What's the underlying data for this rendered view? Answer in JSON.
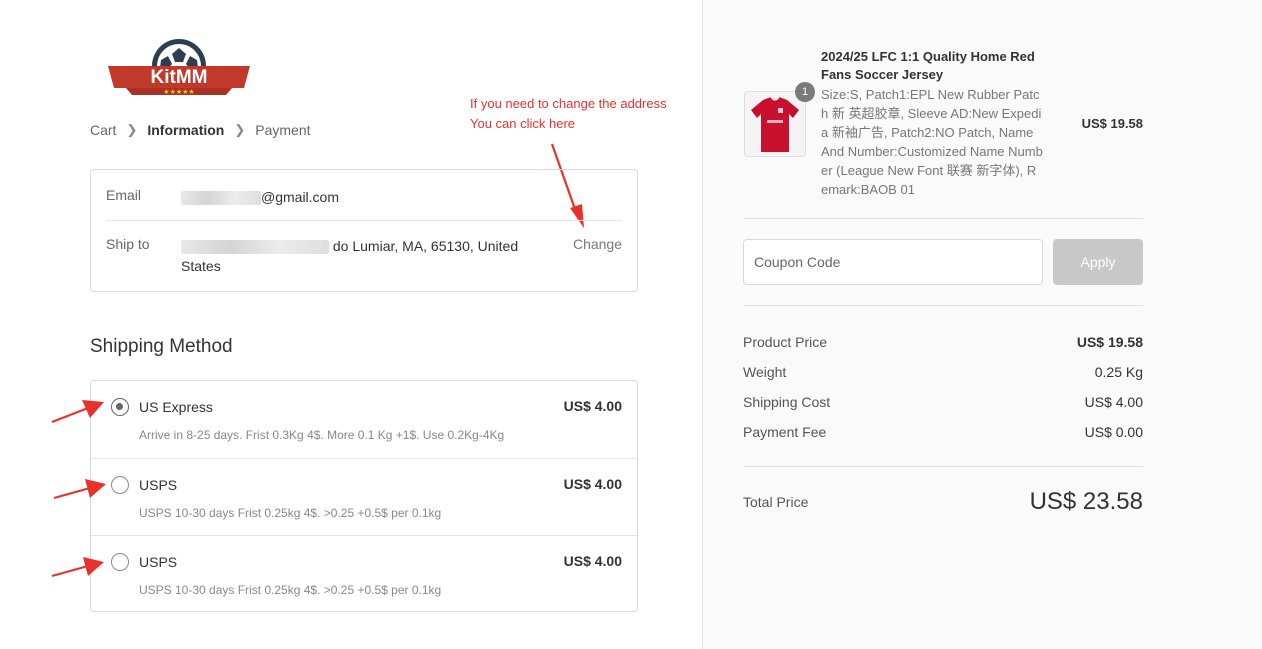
{
  "logo": {
    "text": "KitMM",
    "colors": {
      "primary": "#c0392b",
      "accent": "#f1c40f",
      "dark": "#2c3e50"
    }
  },
  "breadcrumb": {
    "items": [
      "Cart",
      "Information",
      "Payment"
    ],
    "current": "Information",
    "separator_icon": "chevron-right-icon"
  },
  "annotation": {
    "line1": "If you need to change the address",
    "line2": "You can click here",
    "color": "#e8312b"
  },
  "contact": {
    "email_label": "Email",
    "email_value": "@gmail.com",
    "ship_label": "Ship to",
    "ship_value_line1": "do Lumiar, MA, 65130, United",
    "ship_value_line2": "States",
    "change_label": "Change"
  },
  "shipping": {
    "title": "Shipping Method",
    "options": [
      {
        "name": "US Express",
        "price": "US$ 4.00",
        "desc": "Arrive in 8-25 days. Frist 0.3Kg 4$. More 0.1 Kg +1$. Use 0.2Kg-4Kg",
        "selected": true
      },
      {
        "name": "USPS",
        "price": "US$ 4.00",
        "desc": "USPS 10-30 days Frist 0.25kg 4$. >0.25 +0.5$ per 0.1kg",
        "selected": false
      },
      {
        "name": "USPS",
        "price": "US$ 4.00",
        "desc": "USPS 10-30 days Frist 0.25kg 4$. >0.25 +0.5$ per 0.1kg",
        "selected": false
      }
    ]
  },
  "product": {
    "qty": "1",
    "title": "2024/25 LFC 1:1 Quality Home Red Fans Soccer Jersey",
    "attrs": "Size:S, Patch1:EPL New Rubber Patch 新 英超胶章, Sleeve AD:New Expedia 新袖广告, Patch2:NO Patch, Name And Number:Customized Name Number (League New Font 联赛 新字体), Remark:BAOB 01",
    "price": "US$ 19.58"
  },
  "coupon": {
    "placeholder": "Coupon Code",
    "apply_label": "Apply"
  },
  "summary": {
    "rows": [
      {
        "label": "Product Price",
        "value": "US$ 19.58"
      },
      {
        "label": "Weight",
        "value": "0.25 Kg"
      },
      {
        "label": "Shipping Cost",
        "value": "US$ 4.00"
      },
      {
        "label": "Payment Fee",
        "value": "US$ 0.00"
      }
    ],
    "total_label": "Total Price",
    "total_value": "US$ 23.58"
  }
}
